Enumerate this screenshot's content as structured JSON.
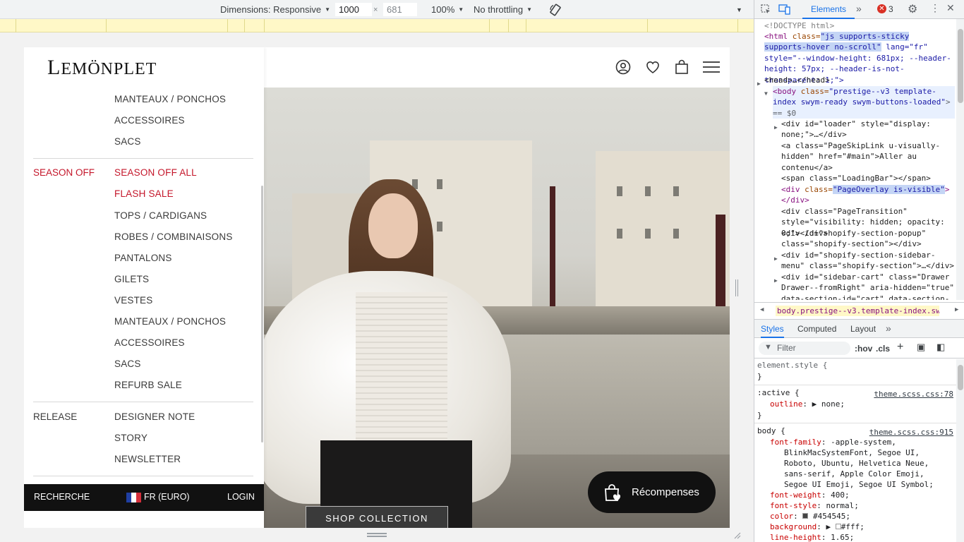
{
  "device_toolbar": {
    "dimensions_label": "Dimensions: Responsive",
    "width_value": "1000",
    "times_sign": "×",
    "height_value": "681",
    "zoom": "100%",
    "throttling": "No throttling"
  },
  "site": {
    "brand": {
      "first": "L",
      "rest": "EMÖNPLET"
    },
    "menu_items": [
      {
        "category": "",
        "label": "MANTEAUX / PONCHOS",
        "highlight": false
      },
      {
        "category": "",
        "label": "ACCESSOIRES",
        "highlight": false
      },
      {
        "category": "",
        "label": "SACS",
        "highlight": false
      },
      {
        "category": "SEASON OFF",
        "label": "SEASON OFF ALL",
        "highlight": true
      },
      {
        "category": "",
        "label": "FLASH SALE",
        "highlight": true
      },
      {
        "category": "",
        "label": "TOPS / CARDIGANS",
        "highlight": false
      },
      {
        "category": "",
        "label": "ROBES / COMBINAISONS",
        "highlight": false
      },
      {
        "category": "",
        "label": "PANTALONS",
        "highlight": false
      },
      {
        "category": "",
        "label": "GILETS",
        "highlight": false
      },
      {
        "category": "",
        "label": "VESTES",
        "highlight": false
      },
      {
        "category": "",
        "label": "MANTEAUX / PONCHOS",
        "highlight": false
      },
      {
        "category": "",
        "label": "ACCESSOIRES",
        "highlight": false
      },
      {
        "category": "",
        "label": "SACS",
        "highlight": false
      },
      {
        "category": "",
        "label": "REFURB SALE",
        "highlight": false
      },
      {
        "category": "RELEASE",
        "label": "DESIGNER NOTE",
        "highlight": false
      },
      {
        "category": "",
        "label": "STORY",
        "highlight": false
      },
      {
        "category": "",
        "label": "NEWSLETTER",
        "highlight": false
      }
    ],
    "footer": {
      "search": "RECHERCHE",
      "locale": "FR (EURO)",
      "login": "LOGIN"
    },
    "shop_button": "SHOP COLLECTION",
    "rewards_button": "Récompenses",
    "colors": {
      "accent_red": "#c4162a",
      "dark": "#111111"
    }
  },
  "devtools": {
    "active_tab": "Elements",
    "error_count": "3",
    "tree": [
      {
        "text": "<!DOCTYPE html>"
      },
      {
        "tag_open": "<html ",
        "attr": "class=",
        "value": "\"js supports-sticky supports-hover no-scroll\"",
        "rest": " lang=\"fr\" style=\"--window-height: 681px; --header-height: 57px; --header-is-not-transparent: 1;\">"
      },
      {
        "text": "<head>…</head>"
      },
      {
        "tag_open": "<body ",
        "attr": "class=",
        "value": "\"prestige--v3 template-index swym-ready swym-buttons-loaded\"",
        "rest": "> == $0"
      },
      {
        "text": "<div id=\"loader\" style=\"display: none;\">…</div>"
      },
      {
        "text": "<a class=\"PageSkipLink u-visually-hidden\" href=\"#main\">Aller au contenu</a>"
      },
      {
        "text": "<span class=\"LoadingBar\"></span>"
      },
      {
        "tag_open": "<div ",
        "attr": "class=",
        "value": "\"PageOverlay is-visible\"",
        "rest": "></div>"
      },
      {
        "text": "<div class=\"PageTransition\" style=\"visibility: hidden; opacity: 0;\"></div>"
      },
      {
        "text": "<div id=\"shopify-section-popup\" class=\"shopify-section\"></div>"
      },
      {
        "text": "<div id=\"shopify-section-sidebar-menu\" class=\"shopify-section\">…</div>"
      },
      {
        "text": "<div id=\"sidebar-cart\" class=\"Drawer Drawer--fromRight\" aria-hidden=\"true\" data-section-id=\"cart\" data-section-"
      }
    ],
    "breadcrumb": "body.prestige--v3.template-index.swym-read",
    "sub_tabs": [
      "Styles",
      "Computed",
      "Layout"
    ],
    "filter_placeholder": "Filter",
    "hov": ":hov",
    "cls": ".cls",
    "styles": {
      "element_style": "element.style {",
      "close_brace": "}",
      "active_selector": ":active {",
      "active_src": "theme.scss.css:78",
      "active_prop": "outline",
      "active_val": "none;",
      "body_selector": "body {",
      "body_src": "theme.scss.css:915",
      "font_family_prop": "font-family",
      "font_family_lines": [
        "-apple-system,",
        "BlinkMacSystemFont, Segoe UI,",
        "Roboto, Ubuntu, Helvetica Neue,",
        "sans-serif, Apple Color Emoji,",
        "Segoe UI Emoji, Segoe UI Symbol;"
      ],
      "font_weight_prop": "font-weight",
      "font_weight_val": "400;",
      "font_style_prop": "font-style",
      "font_style_val": "normal;",
      "color_prop": "color",
      "color_val": "#454545;",
      "background_prop": "background",
      "background_val": "#fff;",
      "line_height_prop": "line-height",
      "line_height_val": "1.65;"
    }
  }
}
